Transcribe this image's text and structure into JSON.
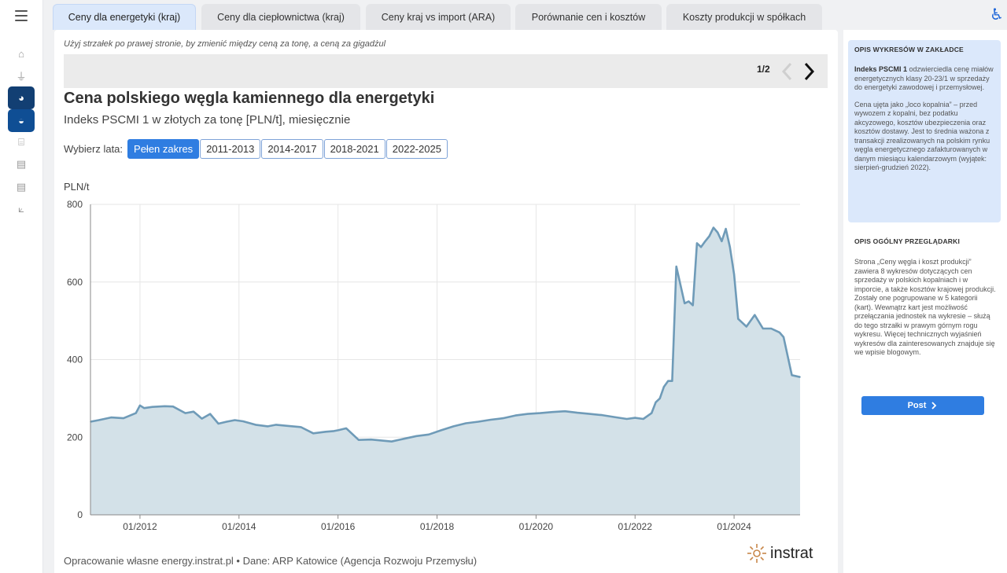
{
  "tabs": [
    {
      "label": "Ceny dla energetyki (kraj)"
    },
    {
      "label": "Ceny dla ciepłownictwa (kraj)"
    },
    {
      "label": "Ceny kraj vs import (ARA)"
    },
    {
      "label": "Porównanie cen i kosztów"
    },
    {
      "label": "Koszty produkcji w spółkach"
    }
  ],
  "main": {
    "hint": "Użyj strzałek po prawej stronie, by zmienić między ceną za tonę, a ceną za gigadżul",
    "pager": "1/2",
    "title": "Cena polskiego węgla kamiennego dla energetyki",
    "subtitle": "Indeks PSCMI 1 w złotych za tonę [PLN/t], miesięcznie",
    "years_label": "Wybierz lata:",
    "year_buttons": [
      "Pełen zakres",
      "2011-2013",
      "2014-2017",
      "2018-2021",
      "2022-2025"
    ],
    "source": "Opracowanie własne energy.instrat.pl • Dane: ARP Katowice (Agencja Rozwoju Przemysłu)",
    "logo": "instrat"
  },
  "sidebar": {
    "box_title": "OPIS WYKRESÓW W ZAKŁADCE",
    "p1_bold": "Indeks PSCMI 1",
    "p1_rest": " odzwierciedla cenę miałów energetycznych klasy 20-23/1 w sprzedaży do energetyki zawodowej i przemysłowej.",
    "p2": "Cena ujęta jako „loco kopalnia” – przed wywozem z kopalni, bez podatku akcyzowego, kosztów ubezpieczenia oraz kosztów dostawy. Jest to średnia ważona z transakcji zrealizowanych na polskim rynku węgla energetycznego zafakturowanych w danym miesiącu kalendarzowym (wyjątek: sierpień-grudzień 2022).",
    "gen_title": "OPIS OGÓLNY PRZEGLĄDARKI",
    "gen_text": "Strona „Ceny węgla i koszt produkcji” zawiera 8 wykresów dotyczących cen sprzedaży w polskich kopalniach i w imporcie, a także kosztów krajowej produkcji. Zostały one pogrupowane w 5 kategorii (kart). Wewnątrz kart jest możliwość przełączania jednostek na wykresie – służą do tego strzałki w prawym górnym rogu wykresu. Więcej technicznych wyjaśnień wykresów dla zainteresowanych znajduje się we wpisie blogowym.",
    "post_label": "Post"
  },
  "colors": {
    "accent": "#2f7de1",
    "line": "#6f9bb8",
    "area": "#d3e1e8"
  },
  "chart_data": {
    "type": "area",
    "ylabel": "PLN/t",
    "ylim": [
      0,
      800
    ],
    "yticks": [
      0,
      200,
      400,
      600,
      800
    ],
    "xticks": [
      "01/2012",
      "01/2014",
      "01/2016",
      "01/2018",
      "01/2020",
      "01/2022",
      "01/2024"
    ],
    "xlim": [
      "2011-01",
      "2025-05"
    ],
    "series": [
      {
        "x": [
          "2011-01",
          "2011-03",
          "2011-06",
          "2011-09",
          "2011-12",
          "2012-01",
          "2012-02",
          "2012-04",
          "2012-07",
          "2012-09",
          "2012-12",
          "2013-02",
          "2013-04",
          "2013-06",
          "2013-08",
          "2013-10",
          "2013-12",
          "2014-02",
          "2014-05",
          "2014-08",
          "2014-10",
          "2015-01",
          "2015-04",
          "2015-07",
          "2015-10",
          "2015-12",
          "2016-01",
          "2016-03",
          "2016-06",
          "2016-09",
          "2016-11",
          "2017-02",
          "2017-05",
          "2017-08",
          "2017-11",
          "2018-02",
          "2018-05",
          "2018-08",
          "2018-11",
          "2019-02",
          "2019-05",
          "2019-08",
          "2019-11",
          "2020-02",
          "2020-05",
          "2020-08",
          "2020-11",
          "2021-02",
          "2021-05",
          "2021-08",
          "2021-11",
          "2022-01",
          "2022-03",
          "2022-05",
          "2022-06",
          "2022-07",
          "2022-08",
          "2022-09",
          "2022-10",
          "2022-11",
          "2023-01",
          "2023-02",
          "2023-03",
          "2023-04",
          "2023-05",
          "2023-06",
          "2023-07",
          "2023-08",
          "2023-09",
          "2023-10",
          "2023-11",
          "2023-12",
          "2024-01",
          "2024-02",
          "2024-04",
          "2024-06",
          "2024-08",
          "2024-10",
          "2024-12",
          "2025-01",
          "2025-03",
          "2025-05"
        ],
        "y": [
          240,
          244,
          251,
          249,
          262,
          282,
          275,
          278,
          280,
          279,
          262,
          266,
          248,
          260,
          235,
          240,
          244,
          241,
          232,
          228,
          232,
          229,
          226,
          210,
          214,
          216,
          218,
          223,
          193,
          194,
          192,
          189,
          196,
          203,
          207,
          218,
          228,
          236,
          240,
          245,
          249,
          256,
          260,
          262,
          265,
          267,
          263,
          260,
          257,
          252,
          247,
          250,
          247,
          262,
          290,
          300,
          330,
          345,
          345,
          640,
          545,
          550,
          540,
          700,
          690,
          705,
          718,
          740,
          728,
          705,
          737,
          690,
          620,
          505,
          485,
          515,
          480,
          480,
          470,
          458,
          360,
          355
        ]
      }
    ]
  }
}
